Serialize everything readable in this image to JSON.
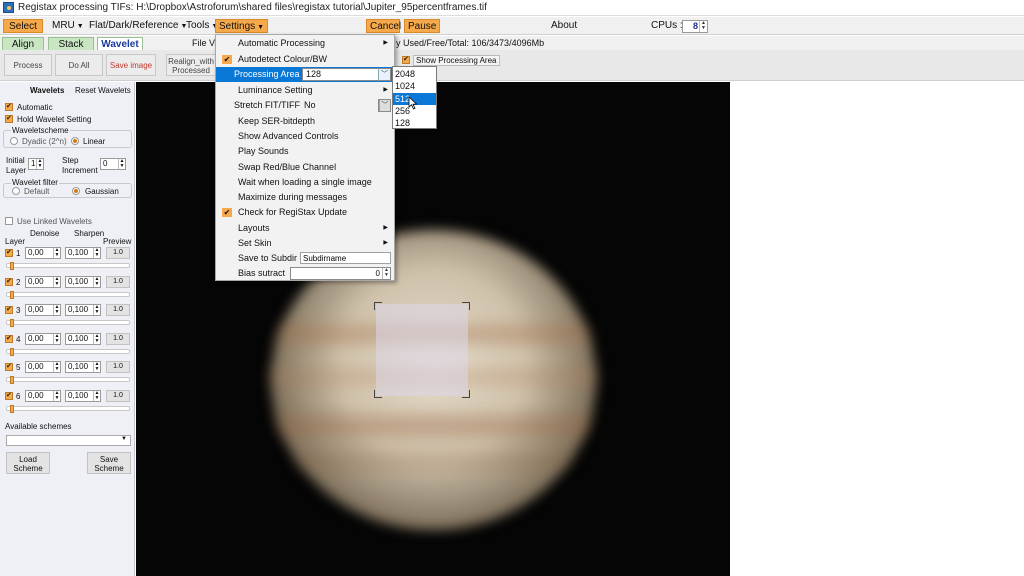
{
  "window": {
    "title": "Registax processing TIFs: H:\\Dropbox\\Astroforum\\shared files\\registax tutorial\\Jupiter_95percentframes.tif"
  },
  "menubar": {
    "select": "Select",
    "mru": "MRU",
    "flat": "Flat/Dark/Reference",
    "tools": "Tools",
    "settings": "Settings",
    "cancel": "Cancel",
    "pause": "Pause",
    "about": "About",
    "cpus_label": "CPUs :",
    "cpus_value": "8"
  },
  "tabs": {
    "align": "Align",
    "stack": "Stack",
    "wavelet": "Wavelet"
  },
  "toolbar": {
    "process": "Process",
    "doall": "Do All",
    "save_image": "Save image",
    "realign_1": "Realign_with",
    "realign_2": "Processed",
    "file_ver": "File Ve",
    "memory": "y Used/Free/Total: 106/3473/4096Mb",
    "show_processing_area": "Show Processing Area"
  },
  "leftpanel": {
    "wavelets_tab": "Wavelets",
    "reset_wavelets": "Reset Wavelets",
    "automatic": "Automatic",
    "hold_wavelet": "Hold Wavelet Setting",
    "waveletscheme": "Waveletscheme",
    "dyadic": "Dyadic (2^n)",
    "linear": "Linear",
    "initial": "Initial",
    "layer_lbl": "Layer",
    "initial_value": "1",
    "step": "Step",
    "increment": "Increment",
    "step_value": "0",
    "wavelet_filter": "Wavelet filter",
    "default": "Default",
    "gaussian": "Gaussian",
    "use_linked": "Use Linked Wavelets",
    "col_layer": "Layer",
    "col_denoise": "Denoise",
    "col_sharpen": "Sharpen",
    "col_preview": "Preview",
    "layers": [
      {
        "n": "1",
        "denoise": "0,00",
        "sharpen": "0,100",
        "preview": "1.0"
      },
      {
        "n": "2",
        "denoise": "0,00",
        "sharpen": "0,100",
        "preview": "1.0"
      },
      {
        "n": "3",
        "denoise": "0,00",
        "sharpen": "0,100",
        "preview": "1.0"
      },
      {
        "n": "4",
        "denoise": "0,00",
        "sharpen": "0,100",
        "preview": "1.0"
      },
      {
        "n": "5",
        "denoise": "0,00",
        "sharpen": "0,100",
        "preview": "1.0"
      },
      {
        "n": "6",
        "denoise": "0,00",
        "sharpen": "0,100",
        "preview": "1.0"
      }
    ],
    "available_schemes": "Available schemes",
    "load_1": "Load",
    "load_2": "Scheme",
    "save_1": "Save",
    "save_2": "Scheme"
  },
  "settings_menu": {
    "items": {
      "automatic_processing": "Automatic Processing",
      "autodetect": "Autodetect Colour/BW",
      "processing_area": "Processing Area",
      "processing_area_value": "128",
      "luminance": "Luminance Setting",
      "stretch": "Stretch FIT/TIFF",
      "stretch_value": "No",
      "keep_ser": "Keep SER-bitdepth",
      "show_advanced": "Show Advanced Controls",
      "play_sounds": "Play Sounds",
      "swap_rb": "Swap Red/Blue Channel",
      "wait_loading": "Wait when loading a single image",
      "maximize": "Maximize during messages",
      "check_update": "Check for RegiStax Update",
      "layouts": "Layouts",
      "set_skin": "Set Skin",
      "save_subdir": "Save to Subdir",
      "save_subdir_value": "Subdirname",
      "bias": "Bias sutract",
      "bias_value": "0"
    }
  },
  "area_options": [
    "2048",
    "1024",
    "512",
    "256",
    "128"
  ],
  "colors": {
    "accent_orange": "#f6a94a",
    "highlight_blue": "#0a78d7",
    "tab_green": "#c9e6c3"
  }
}
